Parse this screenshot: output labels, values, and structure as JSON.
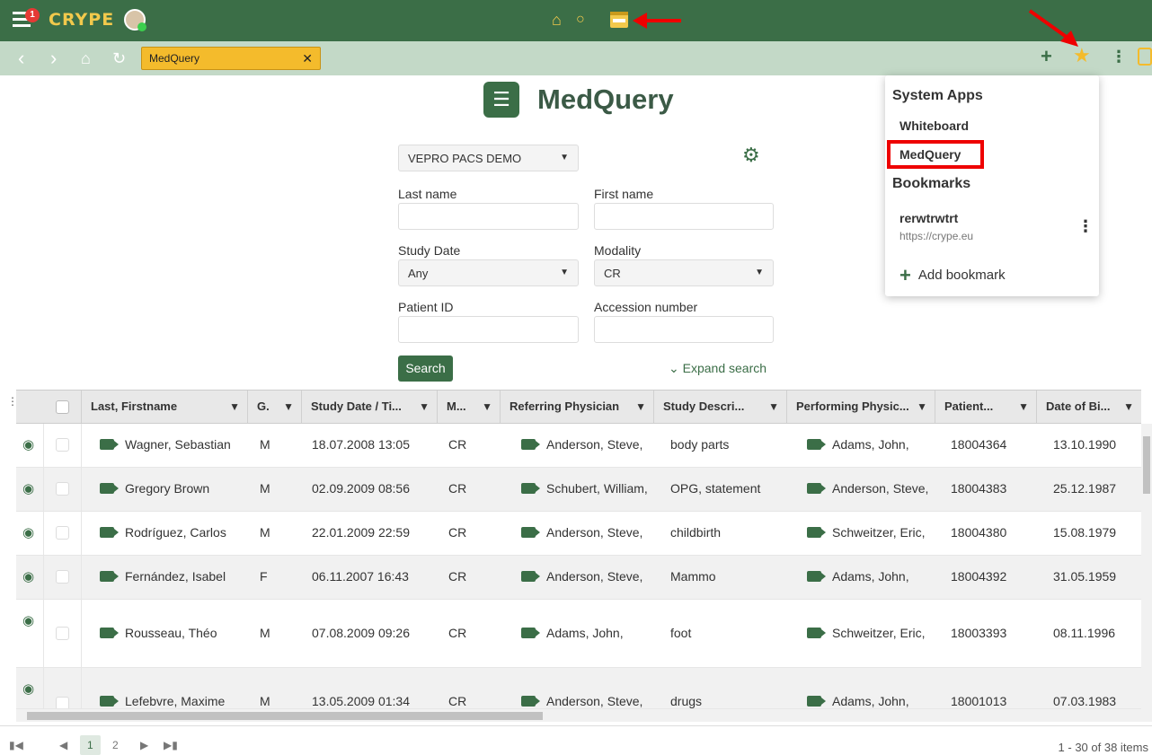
{
  "topbar": {
    "logo": "CRYPE",
    "notification_count": "1"
  },
  "nav": {
    "tab_label": "MedQuery"
  },
  "app": {
    "title": "MedQuery",
    "server": "VEPRO PACS DEMO",
    "last_name_label": "Last name",
    "first_name_label": "First name",
    "study_date_label": "Study Date",
    "study_date_value": "Any",
    "modality_label": "Modality",
    "modality_value": "CR",
    "patient_id_label": "Patient ID",
    "accession_label": "Accession number",
    "search_label": "Search",
    "expand_label": "Expand search"
  },
  "table": {
    "columns": [
      "Last, Firstname",
      "G.",
      "Study Date / Ti...",
      "M...",
      "Referring Physician",
      "Study Descri...",
      "Performing Physic...",
      "Patient...",
      "Date of Bi..."
    ],
    "rows": [
      [
        "Wagner, Sebastian",
        "M",
        "18.07.2008 13:05",
        "CR",
        "Anderson, Steve,",
        "body parts",
        "Adams, John,",
        "18004364",
        "13.10.1990"
      ],
      [
        "Gregory Brown",
        "M",
        "02.09.2009 08:56",
        "CR",
        "Schubert, William,",
        "OPG, statement",
        "Anderson, Steve,",
        "18004383",
        "25.12.1987"
      ],
      [
        "Rodríguez, Carlos",
        "M",
        "22.01.2009 22:59",
        "CR",
        "Anderson, Steve,",
        "childbirth",
        "Schweitzer, Eric,",
        "18004380",
        "15.08.1979"
      ],
      [
        "Fernández, Isabel",
        "F",
        "06.11.2007 16:43",
        "CR",
        "Anderson, Steve,",
        "Mammo",
        "Adams, John,",
        "18004392",
        "31.05.1959"
      ],
      [
        "Rousseau, Théo",
        "M",
        "07.08.2009 09:26",
        "CR",
        "Adams, John,",
        "foot",
        "Schweitzer, Eric,",
        "18003393",
        "08.11.1996"
      ],
      [
        "Lefebvre, Maxime",
        "M",
        "13.05.2009 01:34",
        "CR",
        "Anderson, Steve,",
        "drugs",
        "Adams, John,",
        "18001013",
        "07.03.1983"
      ]
    ]
  },
  "pager": {
    "pages": [
      "1",
      "2"
    ],
    "info": "1 - 30 of 38 items"
  },
  "dropdown": {
    "system_apps_heading": "System Apps",
    "whiteboard": "Whiteboard",
    "medquery": "MedQuery",
    "bookmarks_heading": "Bookmarks",
    "bookmark_name": "rerwtrwtrt",
    "bookmark_url": "https://crype.eu",
    "add_bookmark": "Add bookmark"
  },
  "colors": {
    "brand_green": "#3b6e47",
    "tab_yellow": "#f4bb2c",
    "highlight_red": "#e00000"
  }
}
